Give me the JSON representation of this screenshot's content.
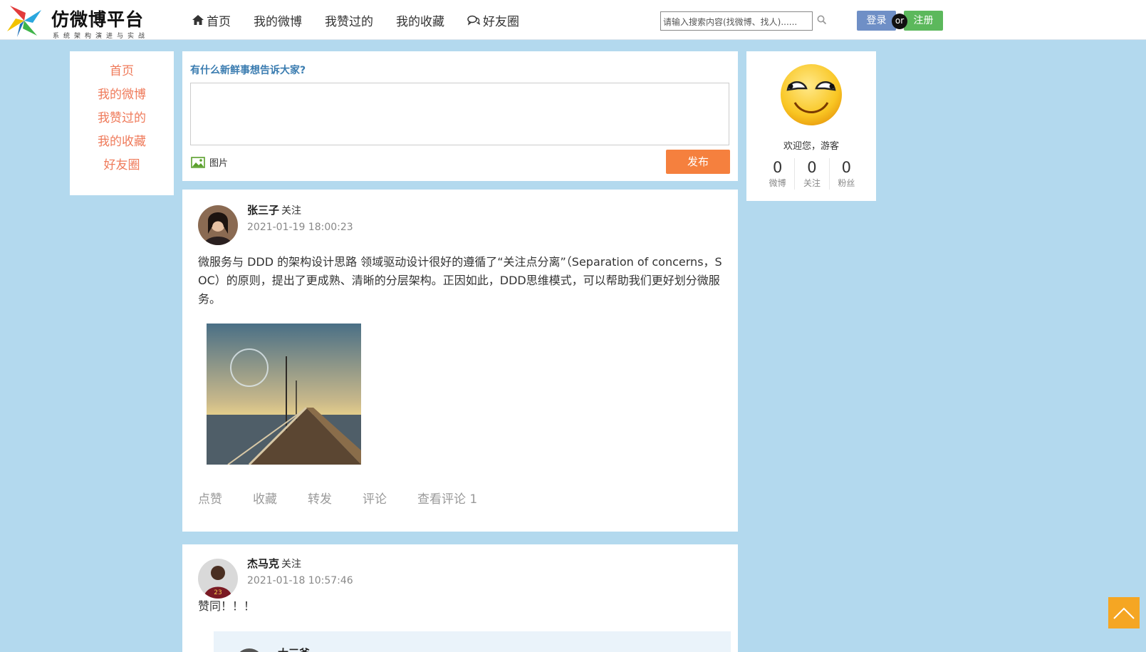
{
  "header": {
    "logo_title": "仿微博平台",
    "logo_subtitle": "系统架构演进与实战",
    "nav": [
      {
        "label": "首页",
        "icon": "home-icon"
      },
      {
        "label": "我的微博"
      },
      {
        "label": "我赞过的"
      },
      {
        "label": "我的收藏"
      },
      {
        "label": "好友圈",
        "icon": "comments-icon"
      }
    ],
    "search_placeholder": "请输入搜索内容(找微博、找人)......",
    "login_label": "登录",
    "or_label": "or",
    "register_label": "注册"
  },
  "left_menu": [
    "首页",
    "我的微博",
    "我赞过的",
    "我的收藏",
    "好友圈"
  ],
  "composer": {
    "title": "有什么新鲜事想告诉大家?",
    "image_label": "图片",
    "publish_label": "发布"
  },
  "posts": [
    {
      "author": "张三子",
      "follow": "关注",
      "time": "2021-01-19 18:00:23",
      "text": "微服务与 DDD 的架构设计思路 领域驱动设计很好的遵循了“关注点分离”（Separation of concerns，SOC）的原则，提出了更成熟、清晰的分层架构。正因如此，DDD思维模式，可以帮助我们更好划分微服务。",
      "actions": [
        "点赞",
        "收藏",
        "转发",
        "评论",
        "查看评论 1"
      ]
    },
    {
      "author": "杰马克",
      "follow": "关注",
      "time": "2021-01-18 10:57:46",
      "text": "赞同！！！",
      "comment_author": "大三爷"
    }
  ],
  "profile": {
    "welcome": "欢迎您，游客",
    "stats": [
      {
        "num": "0",
        "label": "微博"
      },
      {
        "num": "0",
        "label": "关注"
      },
      {
        "num": "0",
        "label": "粉丝"
      }
    ]
  },
  "colors": {
    "page_bg": "#b3d9ee",
    "menu_accent": "#ef7a5a",
    "publish": "#f5803e",
    "login": "#6f8fc6",
    "register": "#5cb85c",
    "back_top": "#f5a623"
  }
}
